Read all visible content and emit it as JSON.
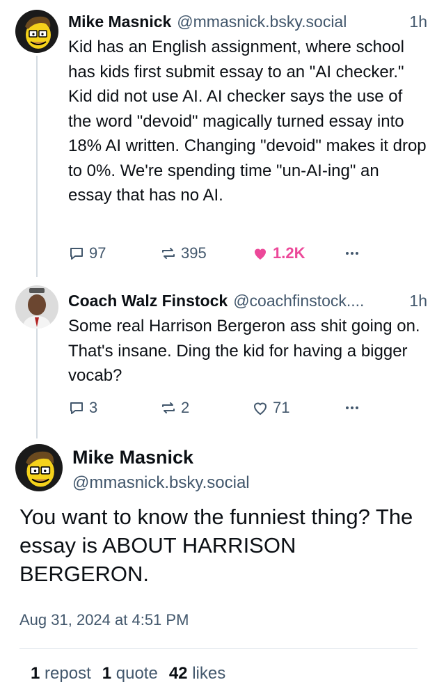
{
  "thread": {
    "reply1": {
      "author_name": "Mike Masnick",
      "author_handle": "@mmasnick.bsky.social",
      "time": "1h",
      "text": "Kid has an English assignment, where school has kids first submit essay to an \"AI checker.\" Kid did not use AI. AI checker says the use of the word \"devoid\" magically turned essay into 18% AI written. Changing \"devoid\" makes it drop to 0%. We're spending time \"un-AI-ing\" an essay that has no AI.",
      "replies": "97",
      "reposts": "395",
      "likes": "1.2K",
      "liked": true
    },
    "reply2": {
      "author_name": "Coach Walz Finstock",
      "author_handle": "@coachfinstock....",
      "time": "1h",
      "text": "Some real Harrison Bergeron ass shit going on. That's insane. Ding the kid for having a bigger vocab?",
      "replies": "3",
      "reposts": "2",
      "likes": "71",
      "liked": false
    }
  },
  "main_post": {
    "author_name": "Mike Masnick",
    "author_handle": "@mmasnick.bsky.social",
    "text": "You want to know the funniest thing? The essay is ABOUT HARRISON BERGERON.",
    "timestamp": "Aug 31, 2024 at 4:51 PM",
    "stats": {
      "reposts_count": "1",
      "reposts_label": "repost",
      "quotes_count": "1",
      "quotes_label": "quote",
      "likes_count": "42",
      "likes_label": "likes"
    }
  },
  "colors": {
    "like_active": "#ec4899",
    "muted": "#42576c",
    "thread_line": "#d4dbe2"
  },
  "icons": [
    "reply-icon",
    "repost-icon",
    "heart-icon",
    "more-icon"
  ]
}
